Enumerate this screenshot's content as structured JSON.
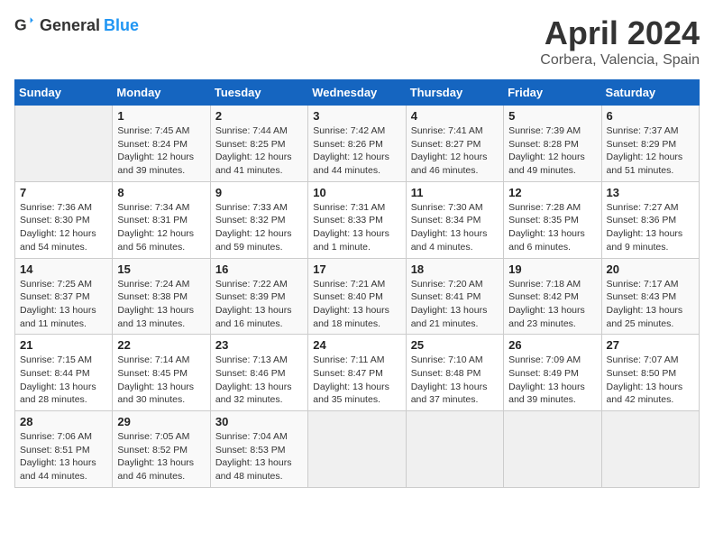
{
  "header": {
    "logo_general": "General",
    "logo_blue": "Blue",
    "month": "April 2024",
    "location": "Corbera, Valencia, Spain"
  },
  "days_of_week": [
    "Sunday",
    "Monday",
    "Tuesday",
    "Wednesday",
    "Thursday",
    "Friday",
    "Saturday"
  ],
  "weeks": [
    [
      {
        "day": "",
        "sunrise": "",
        "sunset": "",
        "daylight": ""
      },
      {
        "day": "1",
        "sunrise": "Sunrise: 7:45 AM",
        "sunset": "Sunset: 8:24 PM",
        "daylight": "Daylight: 12 hours and 39 minutes."
      },
      {
        "day": "2",
        "sunrise": "Sunrise: 7:44 AM",
        "sunset": "Sunset: 8:25 PM",
        "daylight": "Daylight: 12 hours and 41 minutes."
      },
      {
        "day": "3",
        "sunrise": "Sunrise: 7:42 AM",
        "sunset": "Sunset: 8:26 PM",
        "daylight": "Daylight: 12 hours and 44 minutes."
      },
      {
        "day": "4",
        "sunrise": "Sunrise: 7:41 AM",
        "sunset": "Sunset: 8:27 PM",
        "daylight": "Daylight: 12 hours and 46 minutes."
      },
      {
        "day": "5",
        "sunrise": "Sunrise: 7:39 AM",
        "sunset": "Sunset: 8:28 PM",
        "daylight": "Daylight: 12 hours and 49 minutes."
      },
      {
        "day": "6",
        "sunrise": "Sunrise: 7:37 AM",
        "sunset": "Sunset: 8:29 PM",
        "daylight": "Daylight: 12 hours and 51 minutes."
      }
    ],
    [
      {
        "day": "7",
        "sunrise": "Sunrise: 7:36 AM",
        "sunset": "Sunset: 8:30 PM",
        "daylight": "Daylight: 12 hours and 54 minutes."
      },
      {
        "day": "8",
        "sunrise": "Sunrise: 7:34 AM",
        "sunset": "Sunset: 8:31 PM",
        "daylight": "Daylight: 12 hours and 56 minutes."
      },
      {
        "day": "9",
        "sunrise": "Sunrise: 7:33 AM",
        "sunset": "Sunset: 8:32 PM",
        "daylight": "Daylight: 12 hours and 59 minutes."
      },
      {
        "day": "10",
        "sunrise": "Sunrise: 7:31 AM",
        "sunset": "Sunset: 8:33 PM",
        "daylight": "Daylight: 13 hours and 1 minute."
      },
      {
        "day": "11",
        "sunrise": "Sunrise: 7:30 AM",
        "sunset": "Sunset: 8:34 PM",
        "daylight": "Daylight: 13 hours and 4 minutes."
      },
      {
        "day": "12",
        "sunrise": "Sunrise: 7:28 AM",
        "sunset": "Sunset: 8:35 PM",
        "daylight": "Daylight: 13 hours and 6 minutes."
      },
      {
        "day": "13",
        "sunrise": "Sunrise: 7:27 AM",
        "sunset": "Sunset: 8:36 PM",
        "daylight": "Daylight: 13 hours and 9 minutes."
      }
    ],
    [
      {
        "day": "14",
        "sunrise": "Sunrise: 7:25 AM",
        "sunset": "Sunset: 8:37 PM",
        "daylight": "Daylight: 13 hours and 11 minutes."
      },
      {
        "day": "15",
        "sunrise": "Sunrise: 7:24 AM",
        "sunset": "Sunset: 8:38 PM",
        "daylight": "Daylight: 13 hours and 13 minutes."
      },
      {
        "day": "16",
        "sunrise": "Sunrise: 7:22 AM",
        "sunset": "Sunset: 8:39 PM",
        "daylight": "Daylight: 13 hours and 16 minutes."
      },
      {
        "day": "17",
        "sunrise": "Sunrise: 7:21 AM",
        "sunset": "Sunset: 8:40 PM",
        "daylight": "Daylight: 13 hours and 18 minutes."
      },
      {
        "day": "18",
        "sunrise": "Sunrise: 7:20 AM",
        "sunset": "Sunset: 8:41 PM",
        "daylight": "Daylight: 13 hours and 21 minutes."
      },
      {
        "day": "19",
        "sunrise": "Sunrise: 7:18 AM",
        "sunset": "Sunset: 8:42 PM",
        "daylight": "Daylight: 13 hours and 23 minutes."
      },
      {
        "day": "20",
        "sunrise": "Sunrise: 7:17 AM",
        "sunset": "Sunset: 8:43 PM",
        "daylight": "Daylight: 13 hours and 25 minutes."
      }
    ],
    [
      {
        "day": "21",
        "sunrise": "Sunrise: 7:15 AM",
        "sunset": "Sunset: 8:44 PM",
        "daylight": "Daylight: 13 hours and 28 minutes."
      },
      {
        "day": "22",
        "sunrise": "Sunrise: 7:14 AM",
        "sunset": "Sunset: 8:45 PM",
        "daylight": "Daylight: 13 hours and 30 minutes."
      },
      {
        "day": "23",
        "sunrise": "Sunrise: 7:13 AM",
        "sunset": "Sunset: 8:46 PM",
        "daylight": "Daylight: 13 hours and 32 minutes."
      },
      {
        "day": "24",
        "sunrise": "Sunrise: 7:11 AM",
        "sunset": "Sunset: 8:47 PM",
        "daylight": "Daylight: 13 hours and 35 minutes."
      },
      {
        "day": "25",
        "sunrise": "Sunrise: 7:10 AM",
        "sunset": "Sunset: 8:48 PM",
        "daylight": "Daylight: 13 hours and 37 minutes."
      },
      {
        "day": "26",
        "sunrise": "Sunrise: 7:09 AM",
        "sunset": "Sunset: 8:49 PM",
        "daylight": "Daylight: 13 hours and 39 minutes."
      },
      {
        "day": "27",
        "sunrise": "Sunrise: 7:07 AM",
        "sunset": "Sunset: 8:50 PM",
        "daylight": "Daylight: 13 hours and 42 minutes."
      }
    ],
    [
      {
        "day": "28",
        "sunrise": "Sunrise: 7:06 AM",
        "sunset": "Sunset: 8:51 PM",
        "daylight": "Daylight: 13 hours and 44 minutes."
      },
      {
        "day": "29",
        "sunrise": "Sunrise: 7:05 AM",
        "sunset": "Sunset: 8:52 PM",
        "daylight": "Daylight: 13 hours and 46 minutes."
      },
      {
        "day": "30",
        "sunrise": "Sunrise: 7:04 AM",
        "sunset": "Sunset: 8:53 PM",
        "daylight": "Daylight: 13 hours and 48 minutes."
      },
      {
        "day": "",
        "sunrise": "",
        "sunset": "",
        "daylight": ""
      },
      {
        "day": "",
        "sunrise": "",
        "sunset": "",
        "daylight": ""
      },
      {
        "day": "",
        "sunrise": "",
        "sunset": "",
        "daylight": ""
      },
      {
        "day": "",
        "sunrise": "",
        "sunset": "",
        "daylight": ""
      }
    ]
  ]
}
